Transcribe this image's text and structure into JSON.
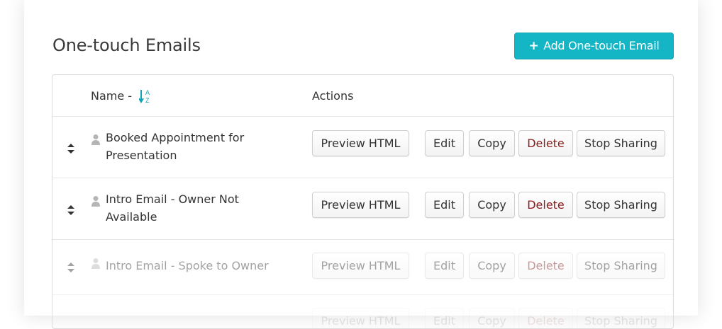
{
  "page": {
    "title": "One-touch Emails"
  },
  "toolbar": {
    "add_label": "Add One-touch Email",
    "add_plus": "+"
  },
  "table": {
    "columns": {
      "name": "Name -",
      "actions": "Actions"
    },
    "sort_icon_letters": {
      "top": "A",
      "bottom": "Z"
    },
    "rows": [
      {
        "name_line1": "Booked Appointment for",
        "name_line2": "Presentation",
        "enabled": true
      },
      {
        "name_line1": "Intro Email - Owner Not",
        "name_line2": "Available",
        "enabled": true
      },
      {
        "name_line1": "Intro Email - Spoke to Owner",
        "name_line2": "",
        "enabled": false
      }
    ],
    "actions": {
      "preview": "Preview HTML",
      "edit": "Edit",
      "copy": "Copy",
      "delete": "Delete",
      "stop": "Stop Sharing"
    }
  },
  "colors": {
    "accent": "#14b6c6",
    "delete_text": "#8b1a1a"
  },
  "icons": {
    "drag": "sort-drag-icon",
    "user": "user-icon",
    "sort": "sort-alpha-icon",
    "add": "plus-icon"
  }
}
